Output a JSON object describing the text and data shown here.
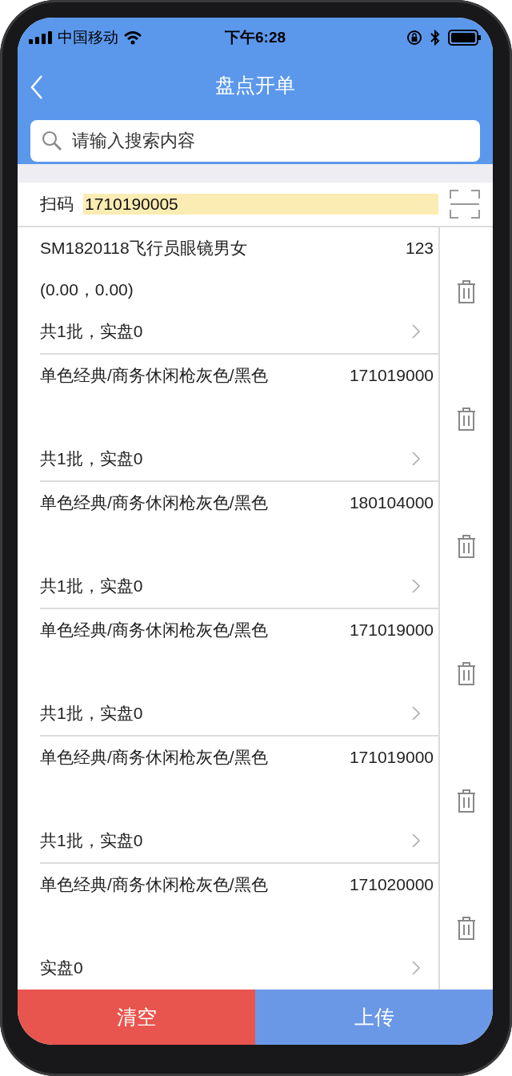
{
  "status_bar": {
    "carrier": "中国移动",
    "time": "下午6:28"
  },
  "nav": {
    "title": "盘点开单"
  },
  "search": {
    "placeholder": "请输入搜索内容"
  },
  "scan": {
    "label": "扫码",
    "value": "1710190005"
  },
  "items": [
    {
      "name": "SM1820118飞行员眼镜男女",
      "code": "123",
      "detail": "(0.00，0.00)",
      "summary": "共1批，实盘0"
    },
    {
      "name": "单色经典/商务休闲枪灰色/黑色",
      "code": "171019000",
      "summary": "共1批，实盘0"
    },
    {
      "name": "单色经典/商务休闲枪灰色/黑色",
      "code": "180104000",
      "summary": "共1批，实盘0"
    },
    {
      "name": "单色经典/商务休闲枪灰色/黑色",
      "code": "171019000",
      "summary": "共1批，实盘0"
    },
    {
      "name": "单色经典/商务休闲枪灰色/黑色",
      "code": "171019000",
      "summary": "共1批，实盘0"
    },
    {
      "name": "单色经典/商务休闲枪灰色/黑色",
      "code": "171020000",
      "summary": "实盘0"
    }
  ],
  "buttons": [
    {
      "label": "清空",
      "kind": "danger"
    },
    {
      "label": "上传",
      "kind": "primary"
    }
  ]
}
